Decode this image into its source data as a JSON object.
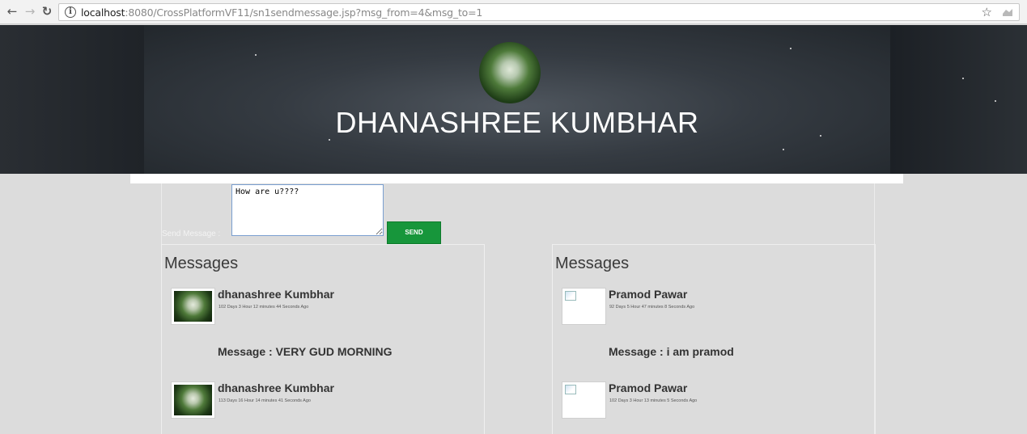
{
  "browser": {
    "url_host": "localhost",
    "url_path": ":8080/CrossPlatformVF11/sn1sendmessage.jsp?msg_from=4&msg_to=1"
  },
  "header": {
    "profile_name": "DHANASHREE KUMBHAR"
  },
  "compose": {
    "label": "Send Message :",
    "value": "How are u????",
    "send_label": "SEND"
  },
  "panels": [
    {
      "title": "Messages",
      "entries": [
        {
          "name": "dhanashree Kumbhar",
          "time": "102 Days 3 Hour 12 minutes 44 Seconds Ago",
          "message": "Message : VERY GUD MORNING",
          "has_image": true
        },
        {
          "name": "dhanashree Kumbhar",
          "time": "113 Days 16 Hour 14 minutes 41 Seconds Ago",
          "has_image": true
        }
      ]
    },
    {
      "title": "Messages",
      "entries": [
        {
          "name": "Pramod Pawar",
          "time": "92 Days 5 Hour 47 minutes 8 Seconds Ago",
          "message": "Message : i am pramod",
          "has_image": false
        },
        {
          "name": "Pramod Pawar",
          "time": "102 Days 3 Hour 13 minutes 5 Seconds Ago",
          "has_image": false
        }
      ]
    }
  ],
  "colors": {
    "send_button": "#17963b",
    "banner_dark": "#23272c",
    "page_bg": "#dcdcdc"
  }
}
